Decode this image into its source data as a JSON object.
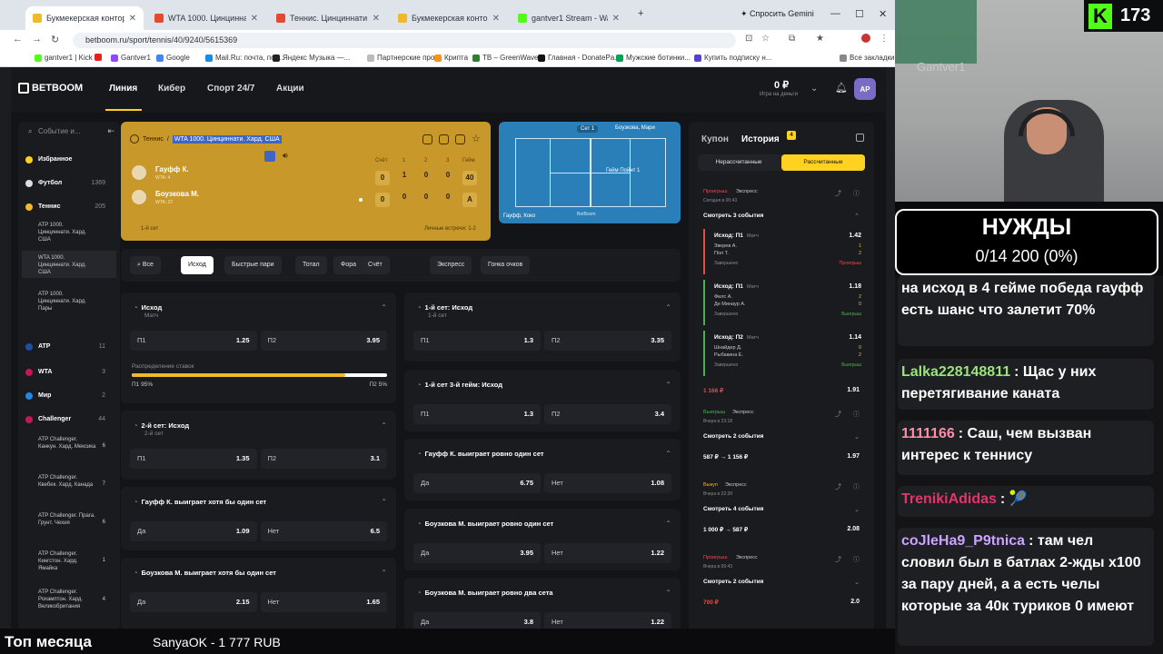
{
  "browser": {
    "tabs": [
      {
        "label": "Букмекерская контора BETBOOM",
        "active": true,
        "color": "#f0b92a"
      },
      {
        "label": "WTA 1000. Цинциннати. Хард",
        "active": false,
        "color": "#e64a2e"
      },
      {
        "label": "Теннис. Цинциннати (ж) 2026",
        "active": false,
        "color": "#e64a2e"
      },
      {
        "label": "Букмекерская контора BETBOOM",
        "active": false,
        "color": "#f0b92a"
      },
      {
        "label": "gantver1 Stream - Watch Live o",
        "active": false,
        "color": "#53fc18"
      }
    ],
    "gemini_label": "Спросить Gemini",
    "url": "betboom.ru/sport/tennis/40/9240/5615369",
    "bookmarks": [
      {
        "label": "gantver1 | Kick",
        "color": "#53fc18"
      },
      {
        "label": "",
        "color": "#e62117"
      },
      {
        "label": "Gantver1",
        "color": "#9146ff"
      },
      {
        "label": "Google",
        "color": "#4285f4"
      },
      {
        "label": "Mail.Ru: почта, пои...",
        "color": "#168de2"
      },
      {
        "label": "Яндекс Музыка —...",
        "color": "#222"
      },
      {
        "label": "Партнерские прог...",
        "color": "#bbb"
      },
      {
        "label": "Криптa",
        "color": "#f7931a"
      },
      {
        "label": "TB – GreenWave",
        "color": "#2e7d32"
      },
      {
        "label": "Главная - DonatePa...",
        "color": "#111"
      },
      {
        "label": "Мужские ботинки...",
        "color": "#00a651"
      },
      {
        "label": "Купить подписку н...",
        "color": "#5b3fd1"
      },
      {
        "label": "Все закладки",
        "color": "#888"
      }
    ]
  },
  "site": {
    "logo": "BETBOOM",
    "nav": [
      "Линия",
      "Кибер",
      "Спорт 24/7",
      "Акции"
    ],
    "balance": "0 ₽",
    "balance_sub": "Игра на деньги",
    "avatar": "АР",
    "search_placeholder": "Событие и...",
    "sidebar": [
      {
        "label": "Избранное",
        "count": "",
        "color": "#ffd21f",
        "kind": "main"
      },
      {
        "label": "Футбол",
        "count": "1369",
        "color": "#ddd",
        "kind": "main"
      },
      {
        "label": "Теннис",
        "count": "205",
        "color": "#f0b92a",
        "kind": "main"
      },
      {
        "label": "ATP 1000. Цинциннати. Хард. США",
        "count": "",
        "kind": "sub",
        "selected": false
      },
      {
        "label": "WTA 1000. Цинциннати. Хард. США",
        "count": "",
        "kind": "sub",
        "selected": true
      },
      {
        "label": "ATP 1000. Цинциннати. Хард. Пары",
        "count": "",
        "kind": "sub",
        "selected": false
      },
      {
        "label": "ATP",
        "count": "11",
        "color": "#1d4ea8",
        "kind": "main"
      },
      {
        "label": "WTA",
        "count": "3",
        "color": "#c2185b",
        "kind": "main"
      },
      {
        "label": "Мир",
        "count": "2",
        "color": "#1e88e5",
        "kind": "main"
      },
      {
        "label": "Challenger",
        "count": "44",
        "color": "#c2185b",
        "kind": "main"
      },
      {
        "label": "ATP Challenger. Канкун. Хард. Мексика",
        "count": "6",
        "kind": "sub",
        "selected": false
      },
      {
        "label": "ATP Challenger. Квебек. Хард. Канада",
        "count": "7",
        "kind": "sub",
        "selected": false
      },
      {
        "label": "ATP Challenger. Прага. Грунт. Чехия",
        "count": "6",
        "kind": "sub",
        "selected": false
      },
      {
        "label": "ATP Challenger. Кингстон. Хард. Ямайка",
        "count": "1",
        "kind": "sub",
        "selected": false
      },
      {
        "label": "ATP Challenger. Рохамптон. Хард. Великобритания",
        "count": "4",
        "kind": "sub",
        "selected": false
      }
    ],
    "match": {
      "breadcrumb_root": "Теннис",
      "breadcrumb_leaf": "WTA 1000. Цинциннати. Хард. США",
      "score_headers": [
        "Счёт",
        "1",
        "2",
        "3",
        "Гейм"
      ],
      "players": [
        {
          "name": "Гауфф К.",
          "rank": "WTA: 4",
          "score": [
            "0",
            "1",
            "0",
            "0",
            "40"
          ]
        },
        {
          "name": "Боузкова М.",
          "rank": "WTA: 22",
          "score": [
            "0",
            "0",
            "0",
            "0",
            "A"
          ]
        }
      ],
      "set_label": "1-й сет",
      "h2h": "Личные встречи: 1-2"
    },
    "court": {
      "set": "Сет 1",
      "top_player": "Боузкова, Мари",
      "bottom_player": "Гауфф, Коко",
      "event": "Гейм Пойнт 1",
      "brand": "BetBoom"
    },
    "filters": [
      "Все",
      "Исход",
      "Быстрые пари",
      "Тотал",
      "Фора",
      "Счёт",
      "Экспресс",
      "Гонка очков"
    ],
    "markets_left": [
      {
        "title": "Исход",
        "sub": "Матч",
        "odds": [
          [
            "П1",
            "1.25"
          ],
          [
            "П2",
            "3.95"
          ]
        ],
        "dist": {
          "label": "Распределение ставок",
          "p1": "П1 95%",
          "p2": "П2 5%",
          "share": 0.95
        }
      },
      {
        "title": "2-й сет: Исход",
        "sub": "2-й сет",
        "odds": [
          [
            "П1",
            "1.35"
          ],
          [
            "П2",
            "3.1"
          ]
        ]
      },
      {
        "title": "Гауфф К. выиграет хотя бы один сет",
        "sub": "",
        "odds": [
          [
            "Да",
            "1.09"
          ],
          [
            "Нет",
            "6.5"
          ]
        ]
      },
      {
        "title": "Боузкова М. выиграет хотя бы один сет",
        "sub": "",
        "odds": [
          [
            "Да",
            "2.15"
          ],
          [
            "Нет",
            "1.65"
          ]
        ]
      }
    ],
    "markets_right": [
      {
        "title": "1-й сет: Исход",
        "sub": "1-й сет",
        "odds": [
          [
            "П1",
            "1.3"
          ],
          [
            "П2",
            "3.35"
          ]
        ]
      },
      {
        "title": "1-й сет 3-й гейм: Исход",
        "sub": "",
        "odds": [
          [
            "П1",
            "1.3"
          ],
          [
            "П2",
            "3.4"
          ]
        ]
      },
      {
        "title": "Гауфф К. выиграет ровно один сет",
        "sub": "",
        "odds": [
          [
            "Да",
            "6.75"
          ],
          [
            "Нет",
            "1.08"
          ]
        ]
      },
      {
        "title": "Боузкова М. выиграет ровно один сет",
        "sub": "",
        "odds": [
          [
            "Да",
            "3.95"
          ],
          [
            "Нет",
            "1.22"
          ]
        ]
      },
      {
        "title": "Боузкова М. выиграет ровно два сета",
        "sub": "",
        "odds": [
          [
            "Да",
            "3.8"
          ],
          [
            "Нет",
            "1.22"
          ]
        ]
      }
    ],
    "coupon": {
      "tab_coupon": "Купон",
      "tab_history": "История",
      "badge": "4",
      "seg_a": "Нерассчитанные",
      "seg_b": "Рассчитанные",
      "bets": [
        {
          "status": "Проигрыш",
          "status_color": "#e84a4a",
          "type": "Экспресс",
          "date": "Сегодня в 00:43",
          "show": "Смотреть 3 события",
          "open": true,
          "selections": [
            {
              "title": "Исход: П1",
              "tag": "Матч",
              "odd": "1.42",
              "p1": "Зверев А.",
              "p2": "Пол Т.",
              "s1": "1",
              "s2": "2",
              "fin": "Завершено",
              "res": "Проигрыш",
              "res_color": "#e84a4a",
              "bar": "#e84a4a"
            },
            {
              "title": "Исход: П1",
              "tag": "Матч",
              "odd": "1.18",
              "p1": "Филс А.",
              "p2": "Де Минаур А.",
              "s1": "2",
              "s2": "0",
              "fin": "Завершено",
              "res": "Выигрыш",
              "res_color": "#4caf50",
              "bar": "#4caf50"
            },
            {
              "title": "Исход: П2",
              "tag": "Матч",
              "odd": "1.14",
              "p1": "Шнайдер Д.",
              "p2": "Рыбакина Е.",
              "s1": "0",
              "s2": "2",
              "fin": "Завершено",
              "res": "Выигрыш",
              "res_color": "#4caf50",
              "bar": "#4caf50"
            }
          ],
          "sum": "1 166 ₽",
          "sum_color": "#e84a4a",
          "coef": "1.91"
        },
        {
          "status": "Выигрыш",
          "status_color": "#4caf50",
          "type": "Экспресс",
          "date": "Вчера в 23:18",
          "show": "Смотреть 2 события",
          "open": false,
          "sum": "587 ₽ → 1 156 ₽",
          "sum_color": "#fff",
          "coef": "1.97"
        },
        {
          "status": "Выкуп",
          "status_color": "#f0b92a",
          "type": "Экспресс",
          "date": "Вчера в 22:39",
          "show": "Смотреть 4 события",
          "open": false,
          "sum": "1 000 ₽ → 587 ₽",
          "sum_color": "#fff",
          "coef": "2.08"
        },
        {
          "status": "Проигрыш",
          "status_color": "#e84a4a",
          "type": "Экспресс",
          "date": "Вчера в 06:43",
          "show": "Смотреть 2 события",
          "open": false,
          "sum": "700 ₽",
          "sum_color": "#e84a4a",
          "coef": "2.0"
        }
      ]
    }
  },
  "stream": {
    "viewers": "173",
    "wall_text": "Gantver1",
    "needs_title": "НУЖДЫ",
    "needs_progress": "0/14 200 (0%)",
    "chat": [
      {
        "user": "",
        "user_color": "#fff",
        "text": "на исход в 4 гейме победа гауфф есть шанс что залетит 70%"
      },
      {
        "user": "Lalka228148811",
        "user_color": "#9be37a",
        "text": ": Щас у них перетягивание каната"
      },
      {
        "user": "1111166",
        "user_color": "#ff8da8",
        "text": ": Саш, чем вызван интерес к теннису"
      },
      {
        "user": "TrenikiAdidas",
        "user_color": "#e2356b",
        "text": ":"
      },
      {
        "user": "coJleHa9_P9tnica",
        "user_color": "#c9a3ff",
        "text": ": там чел словил был в батлах 2-жды x100 за пару дней, а а есть челы которые за 40к туриков 0 имеют"
      }
    ],
    "bottom_left": "Топ месяца",
    "bottom_right": "SanyaOK - 1 777 RUB"
  }
}
